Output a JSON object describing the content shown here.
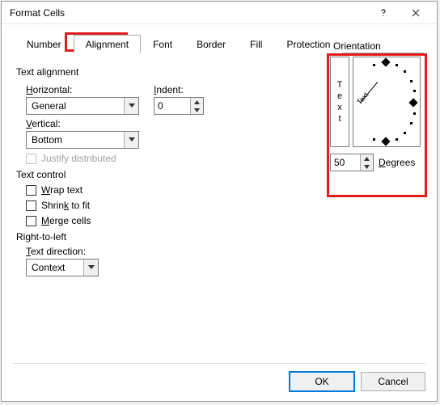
{
  "dialog": {
    "title": "Format Cells"
  },
  "titlebar": {
    "help_icon": "help-icon",
    "close_icon": "close-icon"
  },
  "tabs": {
    "items": [
      {
        "label": "Number"
      },
      {
        "label": "Alignment"
      },
      {
        "label": "Font"
      },
      {
        "label": "Border"
      },
      {
        "label": "Fill"
      },
      {
        "label": "Protection"
      }
    ],
    "active_index": 1
  },
  "sections": {
    "text_alignment": {
      "label": "Text alignment",
      "horizontal": {
        "label": "Horizontal:",
        "value": "General"
      },
      "vertical": {
        "label": "Vertical:",
        "value": "Bottom"
      },
      "indent": {
        "label": "Indent:",
        "value": "0"
      },
      "justify_distributed": {
        "label": "Justify distributed"
      }
    },
    "text_control": {
      "label": "Text control",
      "wrap_text": {
        "label": "Wrap text"
      },
      "shrink_to_fit": {
        "label": "Shrink to fit"
      },
      "merge_cells": {
        "label": "Merge cells"
      }
    },
    "right_to_left": {
      "label": "Right-to-left",
      "text_direction": {
        "label": "Text direction:",
        "value": "Context"
      }
    },
    "orientation": {
      "label": "Orientation",
      "vertical_text": "Text",
      "angled_text": "Text",
      "degrees_value": "50",
      "degrees_label": "Degrees"
    }
  },
  "buttons": {
    "ok": "OK",
    "cancel": "Cancel"
  }
}
